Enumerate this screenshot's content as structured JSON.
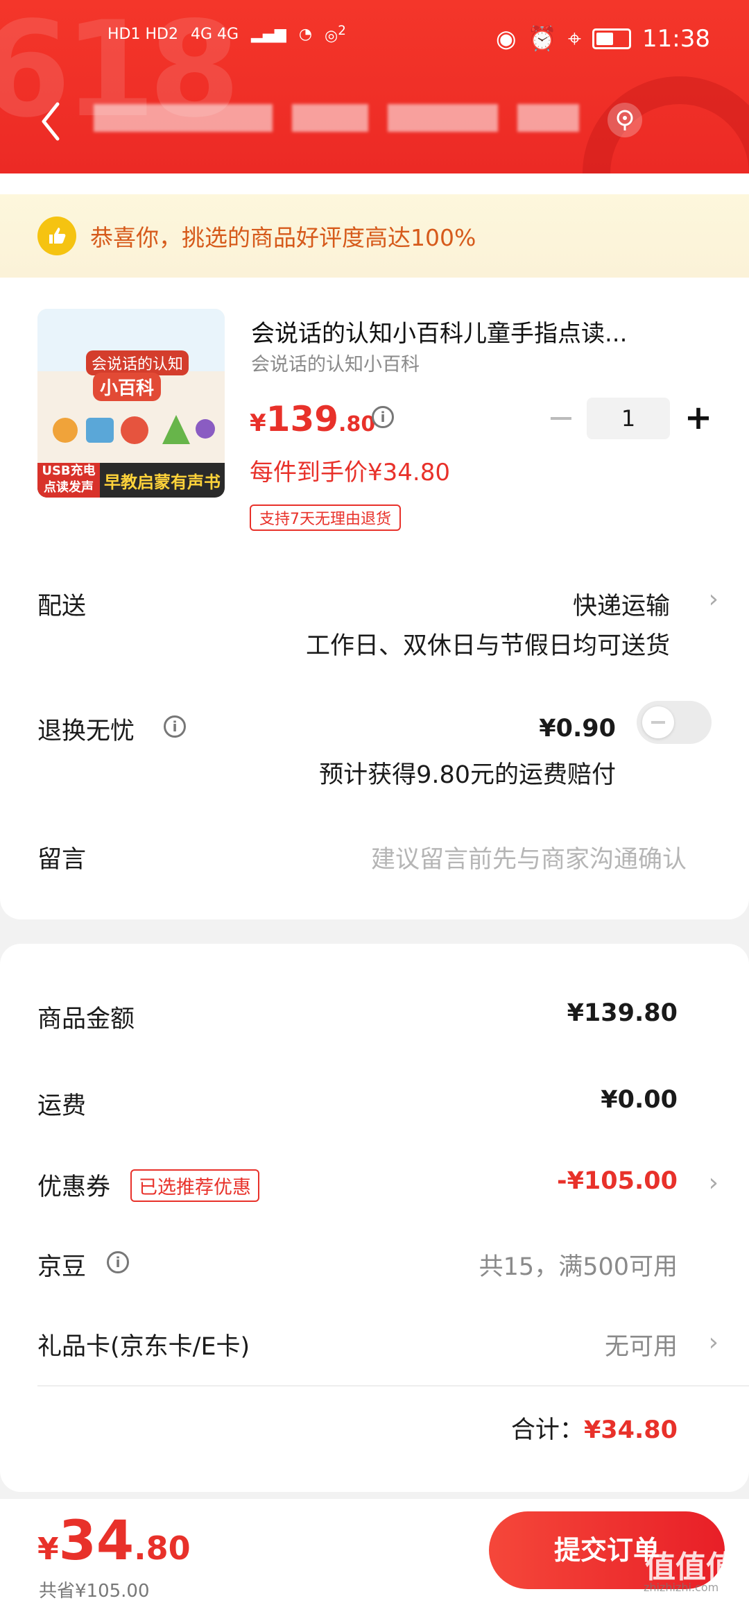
{
  "status_bar": {
    "sim": "HD1 HD2",
    "network": "4G 4G",
    "hotspot_count": "2",
    "time": "11:38",
    "battery_level": 0.55,
    "icons": [
      "eye-comfort-icon",
      "alarm-icon",
      "location-icon",
      "battery-icon",
      "wifi-icon",
      "hotspot-icon"
    ]
  },
  "header": {
    "back_icon": "chevron-left-icon",
    "location_icon": "location-pin-icon",
    "colors": {
      "primary": "#f4362a",
      "accent": "#e8312a"
    }
  },
  "banner": {
    "icon": "thumbs-up-icon",
    "text": "恭喜你，挑选的商品好评度高达100%"
  },
  "product": {
    "title": "会说话的认知小百科儿童手指点读...",
    "subtitle": "会说话的认知小百科",
    "price_currency": "¥",
    "price_int": "139",
    "price_dec": ".80",
    "unit_price": "每件到手价¥34.80",
    "return_tag": "支持7天无理由退货",
    "quantity": "1",
    "minus": "−",
    "plus": "+",
    "cover": {
      "title_line1": "会说话的认知",
      "title_line2": "小百科",
      "badge": "USB充电",
      "badge2": "点读发声",
      "slogan": "早教启蒙有声书"
    }
  },
  "delivery": {
    "label": "配送",
    "method": "快递运输",
    "note": "工作日、双休日与节假日均可送货"
  },
  "return_insurance": {
    "label": "退换无忧",
    "price": "¥0.90",
    "note": "预计获得9.80元的运费赔付",
    "enabled": false
  },
  "message": {
    "label": "留言",
    "placeholder": "建议留言前先与商家沟通确认"
  },
  "summary": {
    "goods_label": "商品金额",
    "goods_value": "¥139.80",
    "freight_label": "运费",
    "freight_value": "¥0.00",
    "coupon_label": "优惠券",
    "coupon_tag": "已选推荐优惠",
    "coupon_value": "-¥105.00",
    "jd_bean_label": "京豆",
    "jd_bean_value": "共15，满500可用",
    "gift_card_label": "礼品卡(京东卡/E卡)",
    "gift_card_value": "无可用",
    "total_label": "合计：",
    "total_value": "¥34.80"
  },
  "footer": {
    "currency": "¥",
    "amount_int": "34",
    "amount_dec": ".80",
    "saved": "共省¥105.00",
    "submit": "提交订单",
    "watermark": "值值值",
    "watermark_url": "zhizhizhi.com"
  }
}
